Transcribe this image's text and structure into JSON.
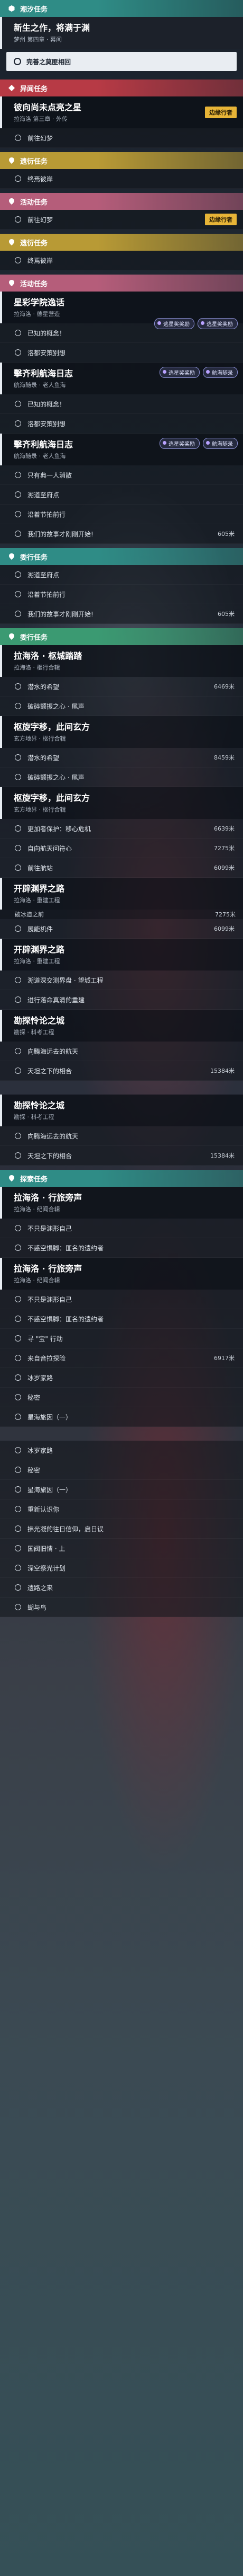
{
  "colors": {
    "teal": "#2f8c86",
    "red": "#b73a45",
    "yellow": "#b89a35",
    "pink": "#b55d7a",
    "green": "#3b9a72",
    "badge": "#e7b437"
  },
  "sections": [
    {
      "type": "cat",
      "color": "teal",
      "icon": "hexagon-icon",
      "label": "潮汐任务"
    },
    {
      "type": "title",
      "name": "新生之作，将满于渊",
      "sub": "梦州 第四章 · 幕间",
      "selected": true
    },
    {
      "type": "selbtn",
      "label": "完善之莫匪相回"
    },
    {
      "type": "gap",
      "size": "s"
    },
    {
      "type": "cat",
      "color": "red",
      "icon": "diamond-icon",
      "label": "异闻任务"
    },
    {
      "type": "title",
      "name": "彼向尚未点亮之星",
      "sub": "拉海洛 第三章 · 外传",
      "badge": "边缘行者"
    },
    {
      "type": "obj",
      "text": "前往幻梦"
    },
    {
      "type": "gap",
      "size": "s"
    },
    {
      "type": "cat",
      "color": "yellow",
      "icon": "pin-icon",
      "label": "遗衍任务"
    },
    {
      "type": "obj",
      "text": "终焉彼岸"
    },
    {
      "type": "gap",
      "size": "s"
    },
    {
      "type": "cat",
      "color": "pink",
      "icon": "pin-icon",
      "label": "活动任务"
    },
    {
      "type": "obj",
      "text": "前往幻梦",
      "badge": "边缘行者"
    },
    {
      "type": "gap",
      "size": "s"
    },
    {
      "type": "cat",
      "color": "yellow",
      "icon": "pin-icon",
      "label": "遗衍任务"
    },
    {
      "type": "obj",
      "text": "终焉彼岸"
    },
    {
      "type": "gap",
      "size": "s"
    },
    {
      "type": "cat",
      "color": "pink",
      "icon": "pin-icon",
      "label": "活动任务"
    },
    {
      "type": "title",
      "name": "星彩学院逸话",
      "sub": "拉海洛 · 德星营造"
    },
    {
      "type": "obj",
      "text": "已知的概念！",
      "reward": [
        "逃星奖奖励",
        "逃星奖奖励"
      ]
    },
    {
      "type": "obj",
      "text": "洛都安策别想"
    },
    {
      "type": "title",
      "name": "擊齐利航海日志",
      "sub": "航海随录 · 老人鱼海",
      "reward": [
        "逃星奖奖励",
        "航海随录"
      ]
    },
    {
      "type": "obj",
      "text": "已知的概念！"
    },
    {
      "type": "obj",
      "text": "洛都安策别想"
    },
    {
      "type": "title",
      "name": "擊齐利航海日志",
      "sub": "航海随录 · 老人鱼海",
      "reward": [
        "逃星奖奖励",
        "航海随录"
      ]
    },
    {
      "type": "obj",
      "text": "只有典一人消散"
    },
    {
      "type": "obj",
      "text": "溯道至府点"
    },
    {
      "type": "obj",
      "text": "沿着节拍前行"
    },
    {
      "type": "obj",
      "text": "我们的故事才刚刚开始!",
      "dist": "605米"
    },
    {
      "type": "gap",
      "size": "s"
    },
    {
      "type": "cat",
      "color": "teal",
      "icon": "pin-icon",
      "label": "委行任务"
    },
    {
      "type": "obj",
      "text": "溯道至府点"
    },
    {
      "type": "obj",
      "text": "沿着节拍前行"
    },
    {
      "type": "obj",
      "text": "我们的故事才刚刚开始!",
      "dist": "605米"
    },
    {
      "type": "gap",
      "size": "s"
    },
    {
      "type": "cat",
      "color": "green",
      "icon": "pin-icon",
      "label": "委行任务"
    },
    {
      "type": "title",
      "name": "拉海洛 · 枢城踏踏",
      "sub": "拉海洛 · 枢行合辑"
    },
    {
      "type": "obj",
      "text": "潜水的希望",
      "dist": "6469米"
    },
    {
      "type": "obj",
      "text": "破碎颤振之心 · 尾声"
    },
    {
      "type": "title",
      "name": "枢旋字移，此间玄方",
      "sub": "玄方地界 · 枢行合辑"
    },
    {
      "type": "obj",
      "text": "潜水的希望",
      "dist": "8459米"
    },
    {
      "type": "obj",
      "text": "破碎颤振之心 · 尾声"
    },
    {
      "type": "title",
      "name": "枢旋字移，此间玄方",
      "sub": "玄方地界 · 枢行合辑"
    },
    {
      "type": "obj",
      "text": "更加者保护：移心危机",
      "dist": "6639米"
    },
    {
      "type": "obj",
      "text": "自向航天问符心",
      "dist": "7275米"
    },
    {
      "type": "obj",
      "text": "前往航站",
      "dist": "6099米"
    },
    {
      "type": "title",
      "name": "开辟渊界之路",
      "sub": "拉海洛 · 重建工程"
    },
    {
      "type": "frag",
      "text": "破冰道之前",
      "dist": "7275米"
    },
    {
      "type": "obj",
      "text": "展能机件",
      "dist": "6099米"
    },
    {
      "type": "title",
      "name": "开辟渊界之路",
      "sub": "拉海洛 · 重建工程"
    },
    {
      "type": "obj",
      "text": "溯道深交测界盘 · 望城工程"
    },
    {
      "type": "obj",
      "text": "进行落命真清的重建"
    },
    {
      "type": "title",
      "name": "勘探怜论之城",
      "sub": "勘探 · 科考工程"
    },
    {
      "type": "obj",
      "text": "向腾海远去的航天"
    },
    {
      "type": "obj",
      "text": "天坦之下的相合",
      "dist": "15384米"
    },
    {
      "type": "gap",
      "size": "l"
    },
    {
      "type": "title",
      "name": "勘探怜论之城",
      "sub": "勘探 · 科考工程"
    },
    {
      "type": "obj",
      "text": "向腾海远去的航天"
    },
    {
      "type": "obj",
      "text": "天坦之下的相合",
      "dist": "15384米"
    },
    {
      "type": "gap",
      "size": "s"
    },
    {
      "type": "cat",
      "color": "teal",
      "icon": "pin-icon",
      "label": "探索任务"
    },
    {
      "type": "title",
      "name": "拉海洛 · 行旅旁声",
      "sub": "拉海洛 · 纪闻合辑"
    },
    {
      "type": "obj",
      "text": "不只是渊形自己"
    },
    {
      "type": "obj",
      "text": "不惑空惧脚：匪名的遗约者"
    },
    {
      "type": "title",
      "name": "拉海洛 · 行旅旁声",
      "sub": "拉海洛 · 纪闻合辑"
    },
    {
      "type": "obj",
      "text": "不只是渊形自己"
    },
    {
      "type": "obj",
      "text": "不惑空惧脚：匪名的遗约者"
    },
    {
      "type": "obj",
      "text": "寻 \"宝\" 行动"
    },
    {
      "type": "obj",
      "text": "来自音拉探险",
      "dist": "6917米"
    },
    {
      "type": "obj",
      "text": "冰岁家路"
    },
    {
      "type": "obj",
      "text": "秘密"
    },
    {
      "type": "obj",
      "text": "星海旅因（一）"
    },
    {
      "type": "gap",
      "size": "l"
    },
    {
      "type": "obj",
      "text": "冰岁家路"
    },
    {
      "type": "obj",
      "text": "秘密"
    },
    {
      "type": "obj",
      "text": "星海旅因（一）"
    },
    {
      "type": "obj",
      "text": "重新认识你"
    },
    {
      "type": "obj",
      "text": "拂光凝的往日信仰，启日误"
    },
    {
      "type": "obj",
      "text": "国阀旧情 · 上"
    },
    {
      "type": "obj",
      "text": "深空祭光计划"
    },
    {
      "type": "obj",
      "text": "遗路之来"
    },
    {
      "type": "obj",
      "text": "蝴与鸟"
    }
  ]
}
